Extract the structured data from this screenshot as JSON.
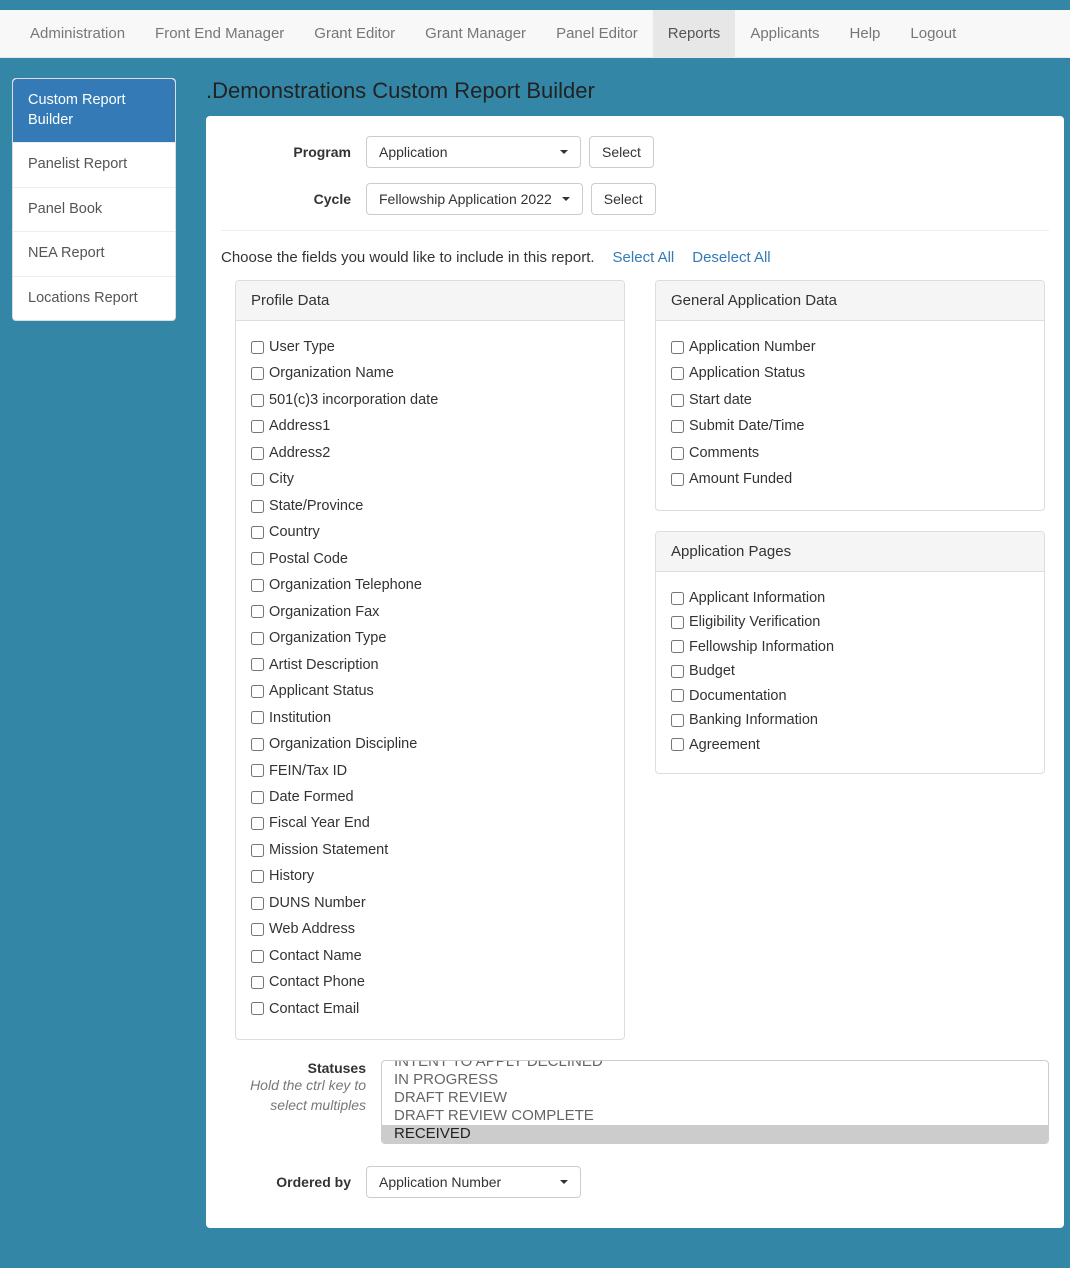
{
  "nav": {
    "items": [
      {
        "label": "Administration"
      },
      {
        "label": "Front End Manager"
      },
      {
        "label": "Grant Editor"
      },
      {
        "label": "Grant Manager"
      },
      {
        "label": "Panel Editor"
      },
      {
        "label": "Reports",
        "active": true
      },
      {
        "label": "Applicants"
      },
      {
        "label": "Help"
      },
      {
        "label": "Logout"
      }
    ]
  },
  "sidebar": {
    "items": [
      {
        "label": "Custom Report Builder",
        "active": true
      },
      {
        "label": "Panelist Report"
      },
      {
        "label": "Panel Book"
      },
      {
        "label": "NEA Report"
      },
      {
        "label": "Locations Report"
      }
    ]
  },
  "page": {
    "title": ".Demonstrations Custom Report Builder"
  },
  "form": {
    "program_label": "Program",
    "program_value": "Application",
    "program_select_btn": "Select",
    "cycle_label": "Cycle",
    "cycle_value": "Fellowship Application 2022",
    "cycle_select_btn": "Select",
    "choose_text": "Choose the fields you would like to include in this report.",
    "select_all": "Select All",
    "deselect_all": "Deselect All"
  },
  "groups": {
    "profile": {
      "title": "Profile Data",
      "fields": [
        "User Type",
        "Organization Name",
        "501(c)3 incorporation date",
        "Address1",
        "Address2",
        "City",
        "State/Province",
        "Country",
        "Postal Code",
        "Organization Telephone",
        "Organization Fax",
        "Organization Type",
        "Artist Description",
        "Applicant Status",
        "Institution",
        "Organization Discipline",
        "FEIN/Tax ID",
        "Date Formed",
        "Fiscal Year End",
        "Mission Statement",
        "History",
        "DUNS Number",
        "Web Address",
        "Contact Name",
        "Contact Phone",
        "Contact Email"
      ]
    },
    "general": {
      "title": "General Application Data",
      "fields": [
        "Application Number",
        "Application Status",
        "Start date",
        "Submit Date/Time",
        "Comments",
        "Amount Funded"
      ]
    },
    "pages": {
      "title": "Application Pages",
      "fields": [
        "Applicant Information",
        "Eligibility Verification",
        "Fellowship Information",
        "Budget",
        "Documentation",
        "Banking Information",
        "Agreement"
      ]
    }
  },
  "statuses": {
    "label": "Statuses",
    "help": "Hold the ctrl key to select multiples",
    "options": [
      {
        "label": "INTENT TO APPLY DECLINED",
        "selected": false
      },
      {
        "label": "IN PROGRESS",
        "selected": false
      },
      {
        "label": "DRAFT REVIEW",
        "selected": false
      },
      {
        "label": "DRAFT REVIEW COMPLETE",
        "selected": false
      },
      {
        "label": "RECEIVED",
        "selected": true
      }
    ]
  },
  "ordered": {
    "label": "Ordered by",
    "value": "Application Number"
  }
}
